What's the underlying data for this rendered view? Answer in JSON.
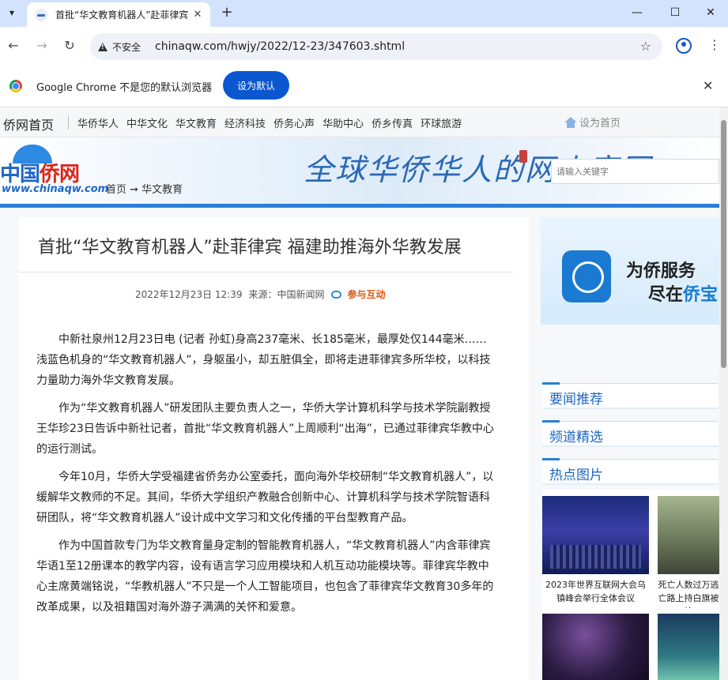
{
  "browser": {
    "tab_title": "首批“华文教育机器人”赴菲律宾",
    "new_tab": "+",
    "security_label": "不安全",
    "url": "chinaqw.com/hwjy/2022/12-23/347603.shtml",
    "infobar_text": "Google Chrome 不是您的默认浏览器",
    "infobar_button": "设为默认"
  },
  "site": {
    "home": "侨网首页",
    "nav": [
      "华侨华人",
      "中华文化",
      "华文教育",
      "经济科技",
      "侨务心声",
      "华助中心",
      "侨乡传真",
      "环球旅游"
    ],
    "set_home": "设为首页",
    "logo_part1": "中国",
    "logo_part2": "侨网",
    "logo_url": "www.chinaqw.com",
    "breadcrumb": "首页 ➞ 华文教育",
    "slogan": "全球华侨华人的网上家园",
    "search_placeholder": "请输入关键字"
  },
  "article": {
    "title": "首批“华文教育机器人”赴菲律宾 福建助推海外华教发展",
    "date": "2022年12月23日 12:39",
    "source": "来源：中国新闻网",
    "interact": "参与互动",
    "paragraphs": [
      "中新社泉州12月23日电 (记者 孙虹)身高237毫米、长185毫米，最厚处仅144毫米……浅蓝色机身的“华文教育机器人”，身躯虽小，却五脏俱全，即将走进菲律宾多所华校，以科技力量助力海外华文教育发展。",
      "作为“华文教育机器人”研发团队主要负责人之一，华侨大学计算机科学与技术学院副教授王华珍23日告诉中新社记者，首批“华文教育机器人”上周顺利“出海”，已通过菲律宾华教中心的运行测试。",
      "今年10月，华侨大学受福建省侨务办公室委托，面向海外华校研制“华文教育机器人”，以缓解华文教师的不足。其间，华侨大学组织产教融合创新中心、计算机科学与技术学院智语科研团队，将“华文教育机器人”设计成中文学习和文化传播的平台型教育产品。",
      "作为中国首款专门为华文教育量身定制的智能教育机器人，“华文教育机器人”内含菲律宾华语1至12册课本的教学内容，设有语言学习应用模块和人机互动功能模块等。菲律宾华教中心主席黄端铭说，“华教机器人”不只是一个人工智能项目，也包含了菲律宾华文教育30多年的改革成果，以及祖籍国对海外游子满满的关怀和爱意。"
    ]
  },
  "sidebar": {
    "ad_line1": "为侨服务",
    "ad_line2a": "尽在",
    "ad_line2b": "侨宝",
    "sections": [
      "要闻推荐",
      "频道精选",
      "热点图片"
    ],
    "photo_captions": [
      "2023年世界互联网大会乌镇峰会举行全体会议",
      "死亡人数过万逃亡路上持白旗被枪"
    ]
  },
  "colors": {
    "accent_blue": "#1d66c4",
    "chrome_button": "#0b57d0",
    "interact_orange": "#e0550b"
  }
}
